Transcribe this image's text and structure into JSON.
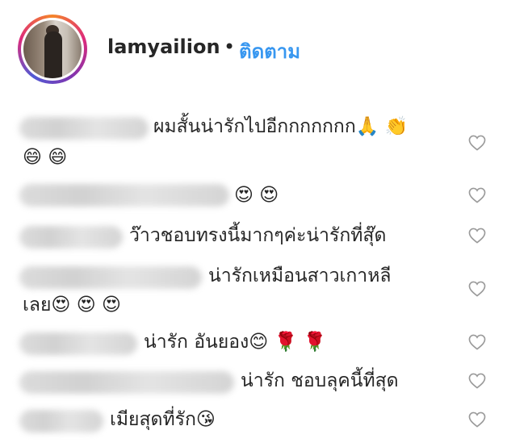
{
  "post": {
    "username": "lamyailion",
    "separator": "•",
    "follow_label": "ติดตาม"
  },
  "icons": {
    "like": "heart-outline-icon",
    "avatar_badge": "story-ring"
  },
  "comments": [
    {
      "text_line1": "ผมสั้นน่ารักไปอีกกกกกกก🙏 👏",
      "text_line2": "😄 😄"
    },
    {
      "text_line1": "😍 😍"
    },
    {
      "text_line1": "ว๊าวชอบทรงนี้มากๆค่ะน่ารักที่สุ๊ด"
    },
    {
      "text_line1": "น่ารักเหมือนสาวเกาหลี",
      "text_line2": "เลย😍 😍 😍"
    },
    {
      "text_line1": "น่ารัก อันยอง😊 🌹 🌹"
    },
    {
      "text_line1": "น่ารัก ชอบลุคนี้ที่สุด"
    },
    {
      "text_line1": "เมียสุดที่รัก😘"
    }
  ]
}
